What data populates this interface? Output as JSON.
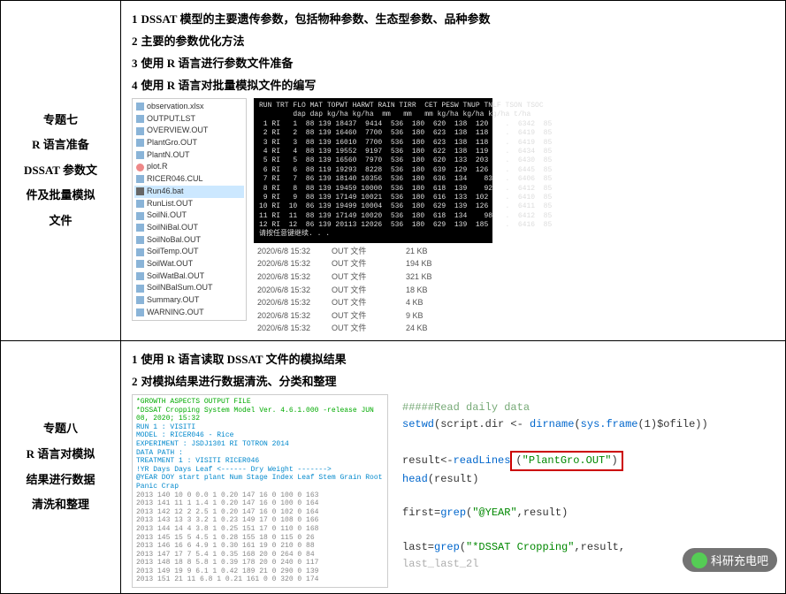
{
  "rows": [
    {
      "title": "专题七\nR 语言准备\nDSSAT 参数文\n件及批量模拟\n文件",
      "items": [
        {
          "n": "1",
          "txt": "DSSAT 模型的主要遗传参数，包括物种参数、生态型参数、品种参数"
        },
        {
          "n": "2",
          "txt": "主要的参数优化方法"
        },
        {
          "n": "3",
          "txt": "使用 R 语言进行参数文件准备"
        },
        {
          "n": "4",
          "txt": "使用 R 语言对批量模拟文件的编写"
        }
      ],
      "files": [
        "observation.xlsx",
        "OUTPUT.LST",
        "OVERVIEW.OUT",
        "PlantGro.OUT",
        "PlantN.OUT",
        "plot.R",
        "RICER046.CUL",
        "Run46.bat",
        "RunList.OUT",
        "SoilNi.OUT",
        "SoilNiBal.OUT",
        "SoilNoBal.OUT",
        "SoilTemp.OUT",
        "SoilWat.OUT",
        "SoilWatBal.OUT",
        "SoilNBalSum.OUT",
        "Summary.OUT",
        "WARNING.OUT"
      ],
      "file_hi": "Run46.bat",
      "term_hdr": "RUN TRT FLO MAT TOPWT HARWT RAIN TIRR  CET PESW TNUP TNLF TSON TSOC",
      "term_sub": "        dap dap kg/ha kg/ha  mm   mm   mm kg/ha kg/ha kg/ha t/ha",
      "term_rows": [
        " 1 RI   1  88 139 18437  9414  536  180  620  138  120    .  6342  85",
        " 2 RI   2  88 139 16460  7700  536  180  623  138  118    .  6419  85",
        " 3 RI   3  88 139 16010  7700  536  180  623  138  118    .  6419  85",
        " 4 RI   4  88 139 19552  9197  536  180  622  138  119    .  6434  85",
        " 5 RI   5  88 139 16560  7970  536  180  620  133  203    .  6430  85",
        " 6 RI   6  88 119 19293  8228  536  180  639  129  126    .  6445  85",
        " 7 RI   7  86 139 18140 10356  536  180  636  134    83   .  6406  85",
        " 8 RI   8  88 139 19459 10000  536  180  618  139    92   .  6412  85",
        " 9 RI   9  88 139 17149 10021  536  180  616  133  102    .  6410  85",
        "10 RI  10  86 139 19499 10004  536  180  629  139  126    .  6411  85",
        "11 RI  11  88 139 17149 10020  536  180  618  134    98   .  6412  85",
        "12 RI  12  86 139 20113 12026  536  180  629  139  185    .  6416  85"
      ],
      "term_foot": "请按任意键继续. . .",
      "props": [
        [
          "2020/6/8 15:32",
          "OUT 文件",
          "21 KB"
        ],
        [
          "2020/6/8 15:32",
          "OUT 文件",
          "194 KB"
        ],
        [
          "2020/6/8 15:32",
          "OUT 文件",
          "321 KB"
        ],
        [
          "2020/6/8 15:32",
          "OUT 文件",
          "18 KB"
        ],
        [
          "2020/6/8 15:32",
          "OUT 文件",
          "4 KB"
        ],
        [
          "2020/6/8 15:32",
          "OUT 文件",
          "9 KB"
        ],
        [
          "2020/6/8 15:32",
          "OUT 文件",
          "24 KB"
        ]
      ]
    },
    {
      "title": "专题八\nR 语言对模拟\n结果进行数据\n清洗和整理",
      "items": [
        {
          "n": "1",
          "txt": "使用 R 语言读取 DSSAT 文件的模拟结果"
        },
        {
          "n": "2",
          "txt": "对模拟结果进行数据清洗、分类和整理"
        }
      ],
      "txtfile": {
        "head1": "*GROWTH ASPECTS OUTPUT FILE",
        "head2": "*DSSAT Cropping System Model Ver. 4.6.1.000 -release   JUN 08, 2020; 15:32",
        "meta": [
          "RUN        1  : VISITI",
          "MODEL      : RICER046 - Rice",
          "EXPERIMENT : JSDJ1301 RI TOTRON 2014",
          "DATA PATH  :",
          "TREATMENT  1  : VISITI         RICER046"
        ],
        "hdr": "!YR    Days  Days            Leaf   <------ Dry Weight ------->",
        "hdr2": "@YEAR DOY start plant  Num Stage Index  Leaf  Stem Grain Root Panic Crap",
        "data": [
          "2013 140  10   0   0.0   1 0.20  147   16   0  100   0  163",
          "2013 141  11   1   1.4   1 0.20  147   16   0  100   0  164",
          "2013 142  12   2   2.5   1 0.20  147   16   0  102   0  164",
          "2013 143  13   3   3.2   1 0.23  149   17   0  108   0  166",
          "2013 144  14   4   3.8   1 0.25  151   17   0  110   0  168",
          "2013 145  15   5   4.5   1 0.28  155   18   0  115   0   26",
          "2013 146  16   6   4.9   1 0.30  161   19   0  210   0   88",
          "2013 147  17   7   5.4   1 0.35  168   20   0  264   0   84",
          "2013 148  18   8   5.8   1 0.39  178   20   0  240   0  117",
          "2013 149  19   9   6.1   1 0.42  189   21   0  290   0  139",
          "2013 151  21  11   6.8   1 0.21  161     0   0  320   0  174"
        ]
      },
      "code": {
        "c1": "#####Read daily data",
        "l1a": "setwd",
        "l1b": "(script.dir <- ",
        "l1c": "dirname",
        "l1d": "(",
        "l1e": "sys.frame",
        "l1f": "(1)$ofile))",
        "l2a": "result<-",
        "l2b": "readLines",
        "l2c": "(",
        "l2str": "\"PlantGro.OUT\"",
        "l2d": ")",
        "l3a": "head",
        "l3b": "(result)",
        "l4a": "first=",
        "l4b": "grep",
        "l4c": "(",
        "l4s": "\"@YEAR\"",
        "l4d": ",result)",
        "l5a": "last=",
        "l5b": "grep",
        "l5c": "(",
        "l5s": "\"*DSSAT Cropping\"",
        "l5d": ",result,",
        "l6": "last_last_2l"
      }
    }
  ],
  "watermark": "科研充电吧"
}
